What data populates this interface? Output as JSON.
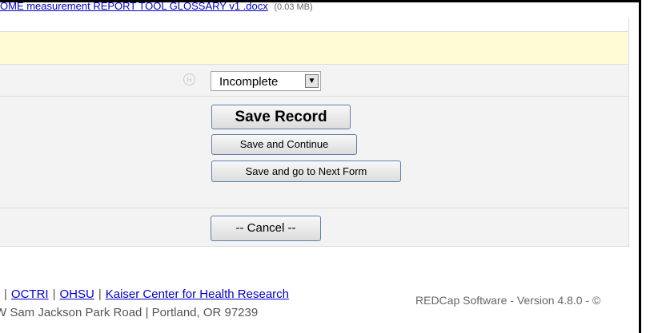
{
  "file_upload": {
    "link_text": "OME measurement REPORT TOOL GLOSSARY v1 .docx",
    "size_text": "(0.03 MB)"
  },
  "status_field": {
    "history_icon": "H",
    "selected_value": "Incomplete"
  },
  "buttons": {
    "save_record": "Save Record",
    "save_continue": "Save and Continue",
    "save_next_form": "Save and go to Next Form",
    "cancel": "-- Cancel --"
  },
  "footer": {
    "links": [
      "OCTRI",
      "OHSU",
      "Kaiser Center for Health Research"
    ],
    "separator": "|",
    "address": "W Sam Jackson Park Road | Portland, OR 97239",
    "version": "REDCap Software - Version 4.8.0 - ©"
  }
}
